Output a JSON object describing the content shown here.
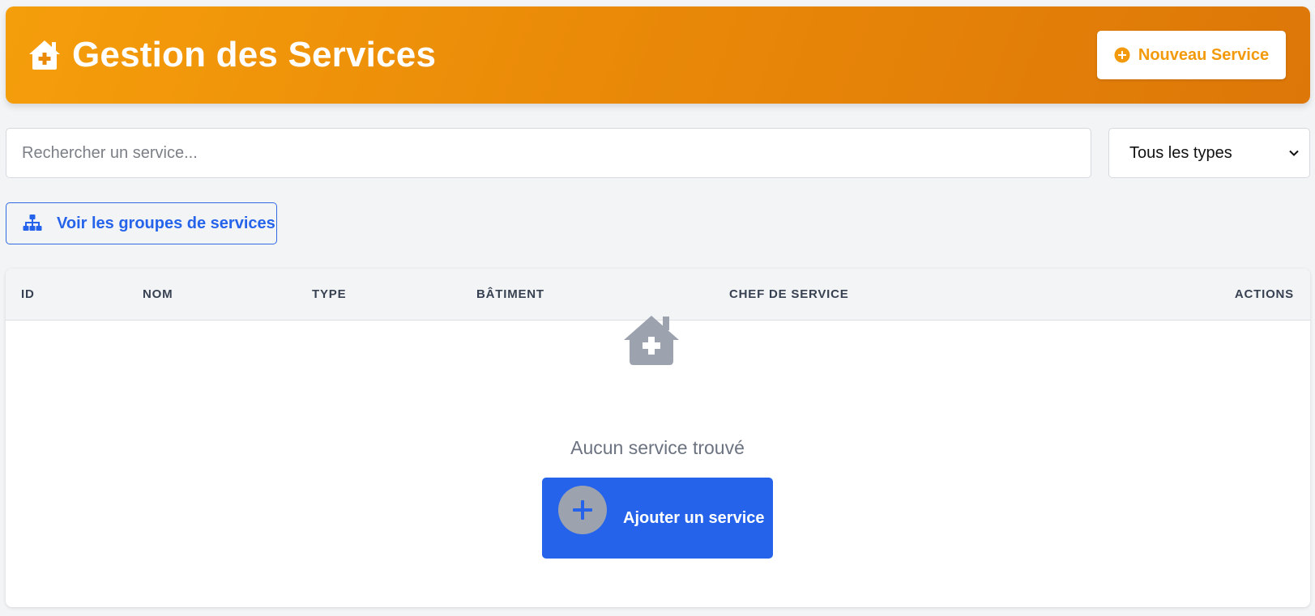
{
  "header": {
    "title": "Gestion des Services",
    "icon": "house-medical-icon",
    "new_button_label": "Nouveau Service",
    "new_button_icon": "plus-circle-icon",
    "gradient_start": "#f59e0b",
    "gradient_end": "#dd7708"
  },
  "filters": {
    "search_placeholder": "Rechercher un service...",
    "type_select_value": "Tous les types"
  },
  "groups_button": {
    "label": "Voir les groupes de services",
    "icon": "sitemap-icon"
  },
  "table": {
    "columns": [
      "ID",
      "NOM",
      "TYPE",
      "BÂTIMENT",
      "CHEF DE SERVICE",
      "ACTIONS"
    ]
  },
  "empty_state": {
    "icon": "house-medical-icon",
    "message": "Aucun service trouvé",
    "add_button_label": "Ajouter un service",
    "add_button_icon": "plus-icon"
  },
  "colors": {
    "accent_orange": "#f29a0c",
    "primary_blue": "#2563eb",
    "page_background": "#f3f4f6"
  }
}
